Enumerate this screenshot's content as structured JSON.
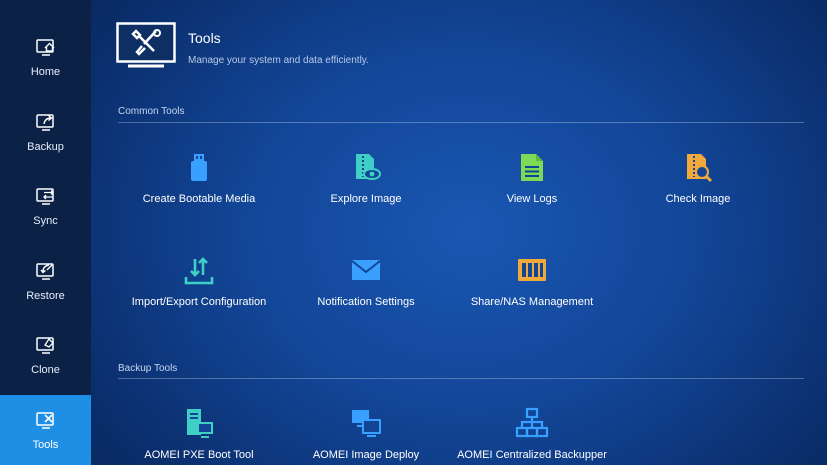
{
  "sidebar": {
    "items": [
      {
        "label": "Home",
        "icon": "home-icon"
      },
      {
        "label": "Backup",
        "icon": "backup-icon"
      },
      {
        "label": "Sync",
        "icon": "sync-icon"
      },
      {
        "label": "Restore",
        "icon": "restore-icon"
      },
      {
        "label": "Clone",
        "icon": "clone-icon"
      },
      {
        "label": "Tools",
        "icon": "tools-icon",
        "active": true
      }
    ]
  },
  "header": {
    "title": "Tools",
    "subtitle": "Manage your system and data efficiently."
  },
  "sections": {
    "common": {
      "title": "Common Tools",
      "tools": [
        {
          "label": "Create Bootable Media",
          "icon": "usb-drive-icon"
        },
        {
          "label": "Explore Image",
          "icon": "explore-image-icon"
        },
        {
          "label": "View Logs",
          "icon": "log-file-icon"
        },
        {
          "label": "Check Image",
          "icon": "check-image-icon"
        },
        {
          "label": "Import/Export Configuration",
          "icon": "import-export-icon"
        },
        {
          "label": "Notification Settings",
          "icon": "envelope-icon"
        },
        {
          "label": "Share/NAS Management",
          "icon": "nas-icon"
        }
      ]
    },
    "backup": {
      "title": "Backup Tools",
      "tools": [
        {
          "label": "AOMEI PXE Boot Tool",
          "icon": "pxe-server-icon"
        },
        {
          "label": "AOMEI Image Deploy",
          "icon": "image-deploy-icon"
        },
        {
          "label": "AOMEI Centralized Backupper",
          "icon": "network-hierarchy-icon"
        }
      ]
    }
  },
  "colors": {
    "sidebar_bg": "#0b2146",
    "active_nav": "#1f8fe5",
    "icon_blue": "#3aa0ff",
    "icon_teal": "#3ed0c4",
    "icon_green": "#7ed957",
    "icon_orange": "#f0a93a"
  }
}
